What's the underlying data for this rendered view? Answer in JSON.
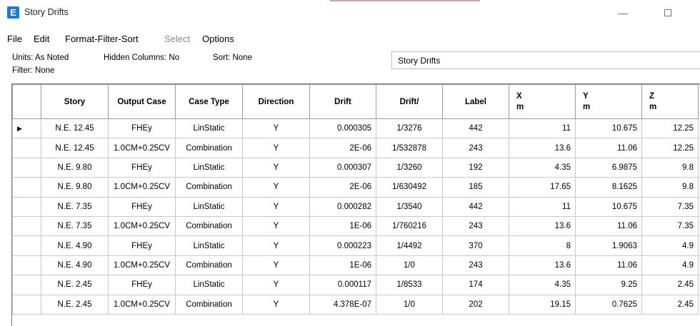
{
  "window": {
    "title": "Story Drifts",
    "app_icon_letter": "E",
    "minimize_glyph": "—"
  },
  "menu": {
    "items": [
      {
        "label": "File",
        "enabled": true
      },
      {
        "label": "Edit",
        "enabled": true
      },
      {
        "label": "Format-Filter-Sort",
        "enabled": true
      },
      {
        "label": "Select",
        "enabled": false
      },
      {
        "label": "Options",
        "enabled": true
      }
    ]
  },
  "info": {
    "units": "Units: As Noted",
    "hidden_columns": "Hidden Columns: No",
    "sort": "Sort: None",
    "filter": "Filter: None",
    "table_title": "Story Drifts"
  },
  "table": {
    "row_selector_glyph": "▶",
    "columns": [
      {
        "label": "Story",
        "unit": ""
      },
      {
        "label": "Output Case",
        "unit": ""
      },
      {
        "label": "Case Type",
        "unit": ""
      },
      {
        "label": "Direction",
        "unit": ""
      },
      {
        "label": "Drift",
        "unit": ""
      },
      {
        "label": "Drift/",
        "unit": ""
      },
      {
        "label": "Label",
        "unit": ""
      },
      {
        "label": "X",
        "unit": "m"
      },
      {
        "label": "Y",
        "unit": "m"
      },
      {
        "label": "Z",
        "unit": "m"
      }
    ],
    "rows": [
      {
        "story": "N.E. 12.45",
        "output_case": "FHEy",
        "case_type": "LinStatic",
        "direction": "Y",
        "drift": "0.000305",
        "drift_ratio": "1/3276",
        "label": "442",
        "x": "11",
        "y": "10.675",
        "z": "12.25"
      },
      {
        "story": "N.E. 12.45",
        "output_case": "1.0CM+0.25CV",
        "case_type": "Combination",
        "direction": "Y",
        "drift": "2E-06",
        "drift_ratio": "1/532878",
        "label": "243",
        "x": "13.6",
        "y": "11.06",
        "z": "12.25"
      },
      {
        "story": "N.E. 9.80",
        "output_case": "FHEy",
        "case_type": "LinStatic",
        "direction": "Y",
        "drift": "0.000307",
        "drift_ratio": "1/3260",
        "label": "192",
        "x": "4.35",
        "y": "6.9875",
        "z": "9.8"
      },
      {
        "story": "N.E. 9.80",
        "output_case": "1.0CM+0.25CV",
        "case_type": "Combination",
        "direction": "Y",
        "drift": "2E-06",
        "drift_ratio": "1/630492",
        "label": "185",
        "x": "17.65",
        "y": "8.1625",
        "z": "9.8"
      },
      {
        "story": "N.E. 7.35",
        "output_case": "FHEy",
        "case_type": "LinStatic",
        "direction": "Y",
        "drift": "0.000282",
        "drift_ratio": "1/3540",
        "label": "442",
        "x": "11",
        "y": "10.675",
        "z": "7.35"
      },
      {
        "story": "N.E. 7.35",
        "output_case": "1.0CM+0.25CV",
        "case_type": "Combination",
        "direction": "Y",
        "drift": "1E-06",
        "drift_ratio": "1/760216",
        "label": "243",
        "x": "13.6",
        "y": "11.06",
        "z": "7.35"
      },
      {
        "story": "N.E. 4.90",
        "output_case": "FHEy",
        "case_type": "LinStatic",
        "direction": "Y",
        "drift": "0.000223",
        "drift_ratio": "1/4492",
        "label": "370",
        "x": "8",
        "y": "1.9063",
        "z": "4.9"
      },
      {
        "story": "N.E. 4.90",
        "output_case": "1.0CM+0.25CV",
        "case_type": "Combination",
        "direction": "Y",
        "drift": "1E-06",
        "drift_ratio": "1/0",
        "label": "243",
        "x": "13.6",
        "y": "11.06",
        "z": "4.9"
      },
      {
        "story": "N.E. 2.45",
        "output_case": "FHEy",
        "case_type": "LinStatic",
        "direction": "Y",
        "drift": "0.000117",
        "drift_ratio": "1/8533",
        "label": "174",
        "x": "4.35",
        "y": "9.25",
        "z": "2.45"
      },
      {
        "story": "N.E. 2.45",
        "output_case": "1.0CM+0.25CV",
        "case_type": "Combination",
        "direction": "Y",
        "drift": "4.378E-07",
        "drift_ratio": "1/0",
        "label": "202",
        "x": "19.15",
        "y": "0.7625",
        "z": "2.45"
      }
    ]
  }
}
